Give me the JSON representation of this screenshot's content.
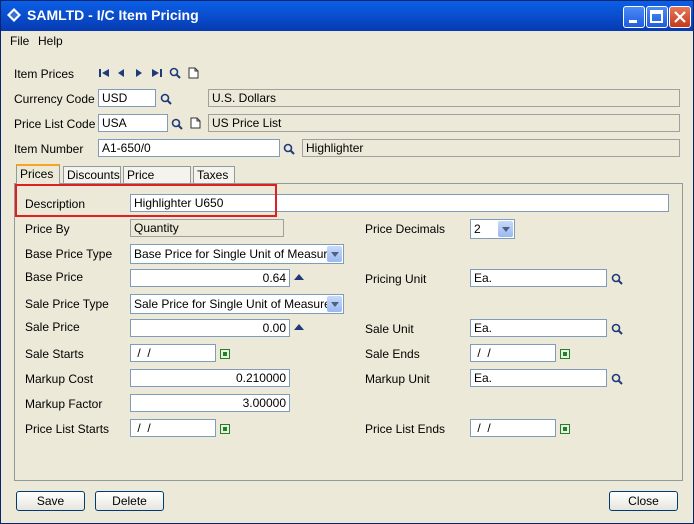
{
  "window": {
    "title": "SAMLTD - I/C Item Pricing"
  },
  "menu": {
    "file": "File",
    "help": "Help"
  },
  "header": {
    "item_prices_label": "Item Prices",
    "currency_code_label": "Currency Code",
    "currency_code_value": "USD",
    "currency_desc": "U.S. Dollars",
    "price_list_code_label": "Price List Code",
    "price_list_code_value": "USA",
    "price_list_desc": "US Price List",
    "item_number_label": "Item Number",
    "item_number_value": "A1-650/0",
    "item_desc": "Highlighter"
  },
  "tabs": [
    "Prices",
    "Discounts",
    "Price Check",
    "Taxes"
  ],
  "prices": {
    "description_label": "Description",
    "description_value": "Highlighter  U650",
    "price_by_label": "Price By",
    "price_by_value": "Quantity",
    "price_decimals_label": "Price Decimals",
    "price_decimals_value": "2",
    "base_price_type_label": "Base Price Type",
    "base_price_type_value": "Base Price for Single Unit of Measure",
    "base_price_label": "Base Price",
    "base_price_value": "0.64",
    "pricing_unit_label": "Pricing Unit",
    "pricing_unit_value": "Ea.",
    "sale_price_type_label": "Sale Price Type",
    "sale_price_type_value": "Sale Price for Single Unit of Measure",
    "sale_price_label": "Sale Price",
    "sale_price_value": "0.00",
    "sale_unit_label": "Sale Unit",
    "sale_unit_value": "Ea.",
    "sale_starts_label": "Sale Starts",
    "sale_starts_value": " /  /",
    "sale_ends_label": "Sale Ends",
    "sale_ends_value": " /  /",
    "markup_cost_label": "Markup Cost",
    "markup_cost_value": "0.210000",
    "markup_unit_label": "Markup Unit",
    "markup_unit_value": "Ea.",
    "markup_factor_label": "Markup Factor",
    "markup_factor_value": "3.00000",
    "price_list_starts_label": "Price List Starts",
    "price_list_starts_value": " /  /",
    "price_list_ends_label": "Price List Ends",
    "price_list_ends_value": " /  /"
  },
  "buttons": {
    "save": "Save",
    "delete": "Delete",
    "close": "Close"
  },
  "icons": [
    "first-icon",
    "prev-icon",
    "next-icon",
    "last-icon",
    "finder-icon",
    "new-document-icon",
    "calendar-icon",
    "spin-up-icon"
  ]
}
